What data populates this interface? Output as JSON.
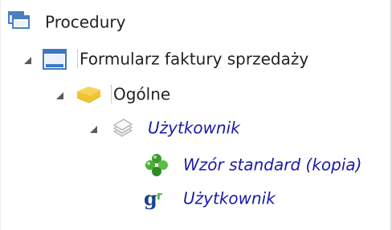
{
  "tree": {
    "nodes": [
      {
        "label": "Procedury",
        "icon": "windows-stack-icon",
        "expanded": true
      },
      {
        "label": "Formularz faktury sprzedaży",
        "icon": "form-window-icon",
        "expanded": true
      },
      {
        "label": "Ogólne",
        "icon": "yellow-folder-icon",
        "expanded": true
      },
      {
        "label": "Użytkownik",
        "icon": "document-stack-icon",
        "expanded": true
      },
      {
        "label": "Wzór standard (kopia)",
        "icon": "green-clover-icon"
      },
      {
        "label": "Użytkownik",
        "icon": "gr-report-icon"
      }
    ]
  },
  "colors": {
    "italic_link": "#1a1aa6",
    "text": "#222222",
    "folder": "#f2c530",
    "form_icon_border": "#3d78c4"
  }
}
